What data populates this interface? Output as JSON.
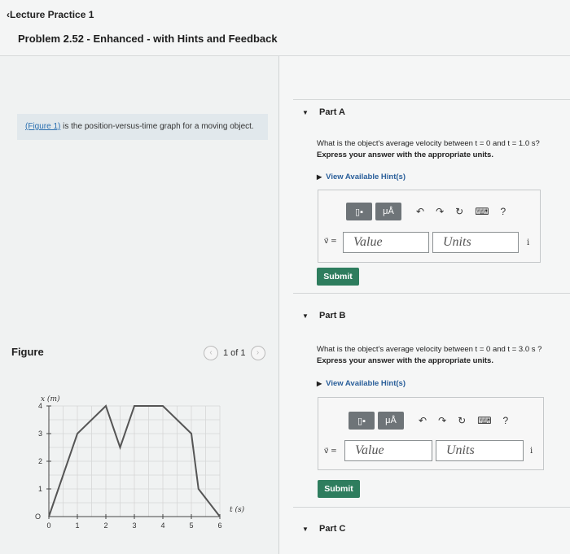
{
  "header": {
    "back_link": "Lecture Practice 1",
    "title": "Problem 2.52 - Enhanced - with Hints and Feedback"
  },
  "figure_note": {
    "link": "(Figure 1)",
    "text": " is the position-versus-time graph for a moving object."
  },
  "figure_panel": {
    "label": "Figure",
    "pager": "1 of 1"
  },
  "chart_data": {
    "type": "line",
    "xlabel": "t (s)",
    "ylabel": "x (m)",
    "xlim": [
      0,
      6
    ],
    "ylim": [
      0,
      4
    ],
    "xticks": [
      "0",
      "1",
      "2",
      "3",
      "4",
      "5",
      "6"
    ],
    "yticks": [
      "0",
      "1",
      "2",
      "3",
      "4"
    ],
    "origin_label": "O",
    "grid": true,
    "series": [
      {
        "x": [
          0,
          1,
          2,
          2.5,
          3,
          4,
          5,
          5.25,
          6
        ],
        "y": [
          0,
          3,
          4,
          2.5,
          4,
          4,
          3,
          1,
          0
        ]
      }
    ]
  },
  "partA": {
    "label": "Part A",
    "question": "What is the object's average velocity between t = 0 and t = 1.0 s?",
    "instruction": "Express your answer with the appropriate units.",
    "hint": "View Available Hint(s)",
    "var": "v⃗ =",
    "value_placeholder": "Value",
    "units_placeholder": "Units",
    "submit": "Submit"
  },
  "partB": {
    "label": "Part B",
    "question": "What is the object's average velocity between t = 0 and t = 3.0 s ?",
    "instruction": "Express your answer with the appropriate units.",
    "hint": "View Available Hint(s)",
    "var": "v⃗ =",
    "value_placeholder": "Value",
    "units_placeholder": "Units",
    "submit": "Submit"
  },
  "partC": {
    "label": "Part C"
  },
  "toolbar": {
    "template": "▯▪",
    "units": "μÅ",
    "undo": "↶",
    "redo": "↷",
    "reset": "↻",
    "keyboard": "⌨",
    "help": "?",
    "info": "i"
  }
}
